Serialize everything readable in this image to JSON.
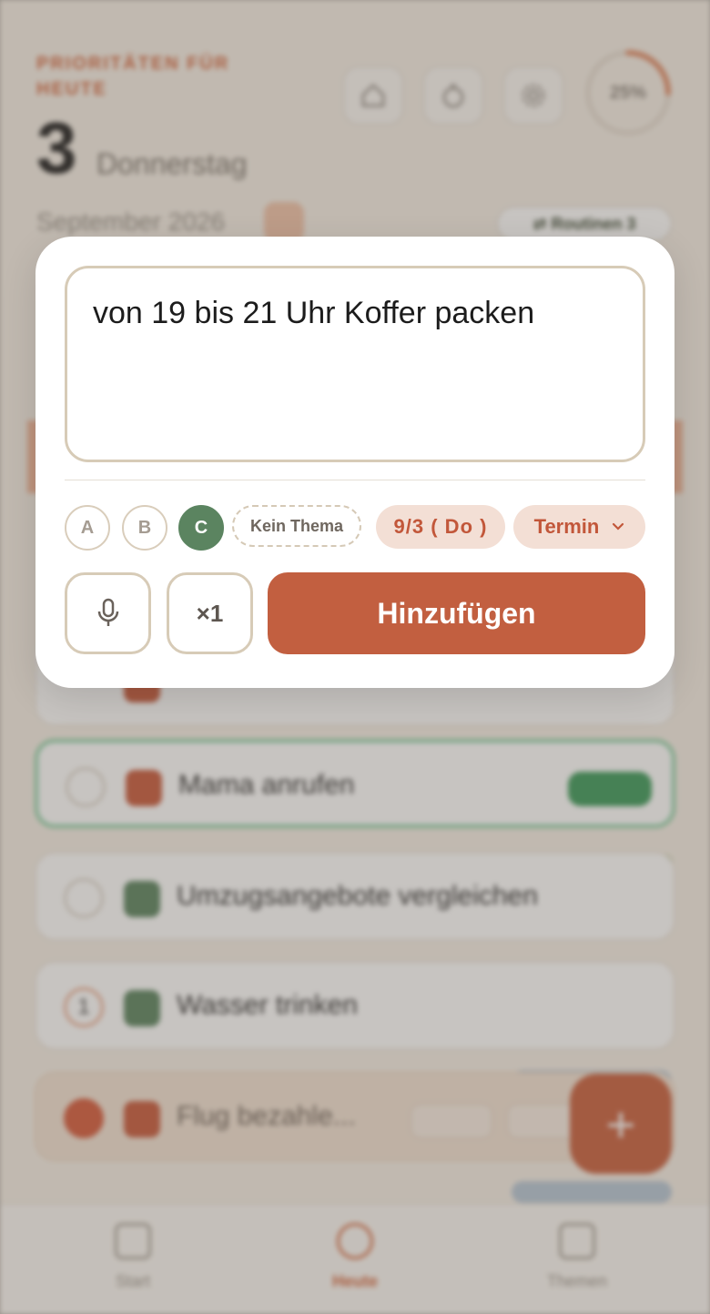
{
  "background": {
    "header_label": "PRIORITÄTEN FÜR HEUTE",
    "day_number": "3",
    "weekday": "Donnerstag",
    "month_year": "September 2026",
    "routines_chip": "⇄ Routinen 3",
    "progress_text": "25%",
    "progress_value": 0.25,
    "tasks": [
      {
        "title": "Mama anrufen",
        "tag_color": "#c85a3c"
      },
      {
        "title": "Umzugsangebote vergleichen",
        "tag_color": "#5b8460"
      },
      {
        "title": "Wasser trinken",
        "tag_color": "#5b8460",
        "counter": "1"
      },
      {
        "title": "Flug bezahle...",
        "tag_color": "#c85a3c"
      }
    ],
    "nav": [
      {
        "label": "Start"
      },
      {
        "label": "Heute"
      },
      {
        "label": "Themen"
      }
    ],
    "fab_label": "+"
  },
  "dialog": {
    "task_text": "von 19 bis 21 Uhr Koffer packen",
    "priorities": [
      "A",
      "B",
      "C"
    ],
    "selected_priority": "C",
    "theme_chip": "Kein Thema",
    "date_chip": "9/3 ( Do )",
    "term_chip": "Termin",
    "repeat_label": "×1",
    "add_label": "Hinzufügen"
  },
  "colors": {
    "accent": "#c25f40",
    "priority_selected": "#5b8460",
    "chip_bg": "#f3dfd5"
  }
}
